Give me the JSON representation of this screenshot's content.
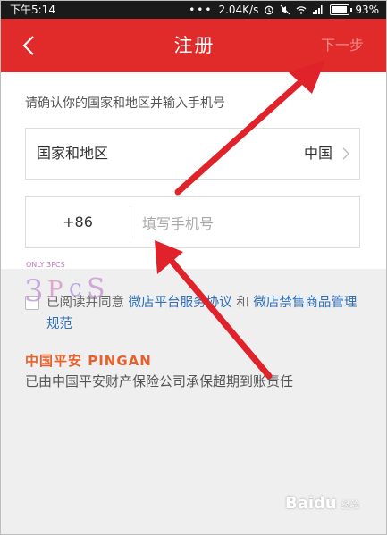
{
  "status_bar": {
    "time": "下午5:14",
    "speed": "2.04K/s",
    "battery": "93%",
    "battery_level": 0.93
  },
  "header": {
    "title": "注册",
    "next_label": "下一步"
  },
  "form": {
    "hint": "请确认你的国家和地区并输入手机号",
    "country_label": "国家和地区",
    "country_value": "中国",
    "phone_code": "+86",
    "phone_placeholder": "填写手机号"
  },
  "agreement": {
    "prefix": "已阅读并同意",
    "link1": "微店平台服务协议",
    "mid": "和",
    "link2": "微店禁售商品管理规范"
  },
  "footer": {
    "brand": "中国平安 PINGAN",
    "insurance": "已由中国平安财产保险公司承保超期到账责任"
  },
  "watermarks": {
    "baidu": "Baidu",
    "baidu_sub": "经验",
    "sticker": "ONLY 3PCS"
  },
  "colors": {
    "header_bg": "#e12a2a",
    "link": "#2f6fb8",
    "pingan": "#e8612c",
    "arrow": "#e0232a"
  }
}
